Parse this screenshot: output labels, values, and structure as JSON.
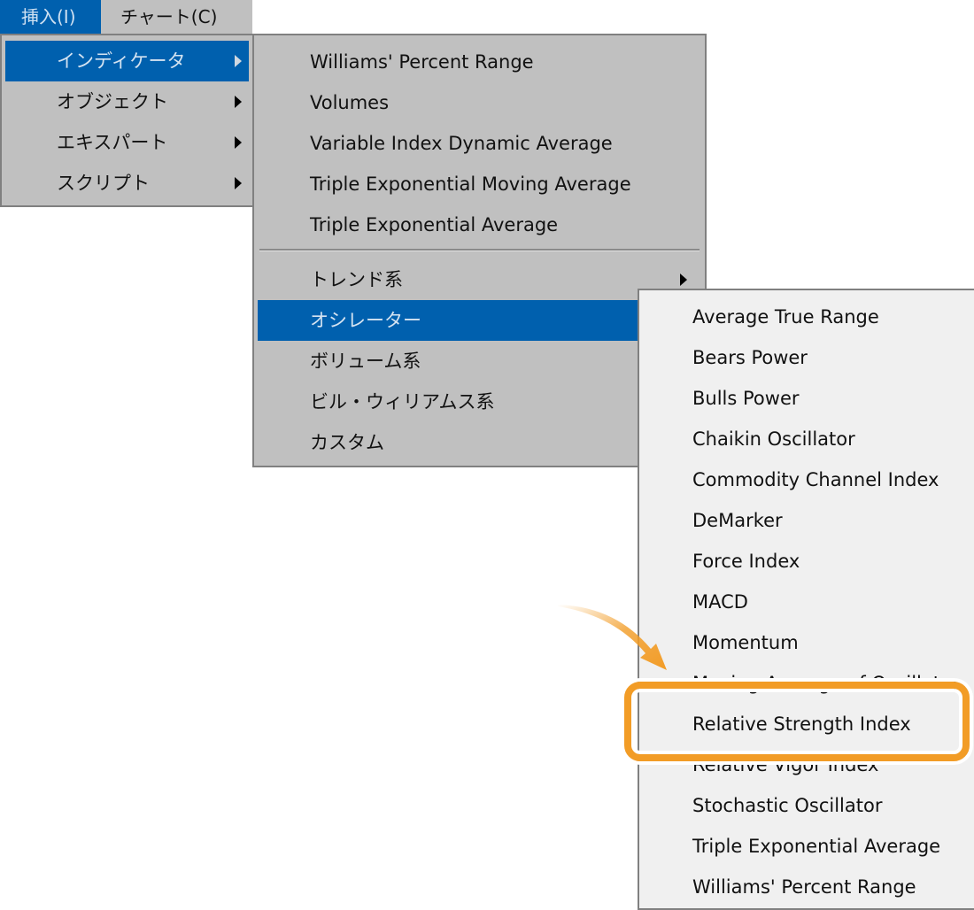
{
  "menubar": {
    "items": [
      {
        "label": "挿入(I)",
        "active": true
      },
      {
        "label": "チャート(C)",
        "active": false
      }
    ]
  },
  "insert_menu": {
    "items": [
      {
        "label": "インディケータ",
        "has_submenu": true,
        "active": true
      },
      {
        "label": "オブジェクト",
        "has_submenu": true,
        "active": false
      },
      {
        "label": "エキスパート",
        "has_submenu": true,
        "active": false
      },
      {
        "label": "スクリプト",
        "has_submenu": true,
        "active": false
      }
    ]
  },
  "indicator_menu": {
    "recent_items": [
      {
        "label": "Williams' Percent Range"
      },
      {
        "label": "Volumes"
      },
      {
        "label": "Variable Index Dynamic Average"
      },
      {
        "label": "Triple Exponential Moving Average"
      },
      {
        "label": "Triple Exponential Average"
      }
    ],
    "category_items": [
      {
        "label": "トレンド系",
        "has_submenu": true,
        "active": false
      },
      {
        "label": "オシレーター",
        "has_submenu": true,
        "active": true
      },
      {
        "label": "ボリューム系",
        "has_submenu": true,
        "active": false
      },
      {
        "label": "ビル・ウィリアムス系",
        "has_submenu": true,
        "active": false
      },
      {
        "label": "カスタム",
        "has_submenu": true,
        "active": false
      }
    ]
  },
  "oscillator_menu": {
    "items": [
      {
        "label": "Average True Range"
      },
      {
        "label": "Bears Power"
      },
      {
        "label": "Bulls Power"
      },
      {
        "label": "Chaikin Oscillator"
      },
      {
        "label": "Commodity Channel Index"
      },
      {
        "label": "DeMarker"
      },
      {
        "label": "Force Index"
      },
      {
        "label": "MACD"
      },
      {
        "label": "Momentum"
      },
      {
        "label": "Moving Average of Oscillator"
      },
      {
        "label": "Relative Strength Index"
      },
      {
        "label": "Relative Vigor Index"
      },
      {
        "label": "Stochastic Oscillator"
      },
      {
        "label": "Triple Exponential Average"
      },
      {
        "label": "Williams' Percent Range"
      }
    ],
    "highlighted_item": "Relative Strength Index"
  },
  "annotation": {
    "highlight_color": "#f29c26",
    "arrow_color": "#f29c26"
  },
  "colors": {
    "menu_bg": "#c0c0c0",
    "submenu_bg": "#f0f0f0",
    "selection_bg": "#0060ae"
  }
}
